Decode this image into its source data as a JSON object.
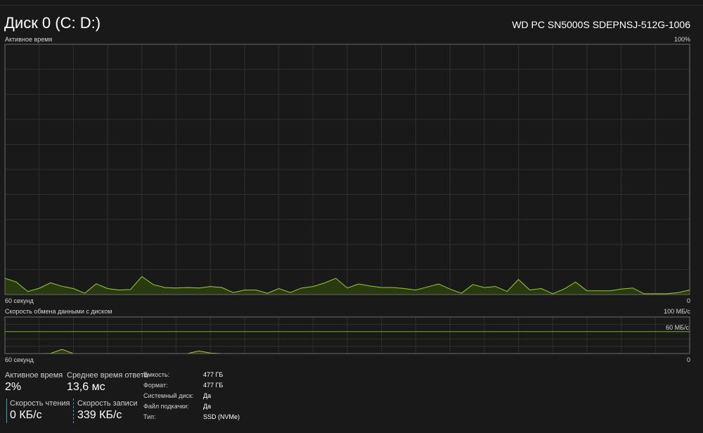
{
  "header": {
    "title": "Диск 0 (C: D:)",
    "model": "WD PC SN5000S SDEPNSJ-512G-1006"
  },
  "active_chart": {
    "label": "Активное время",
    "max_label": "100%",
    "time_label": "60 секунд",
    "min_label": "0",
    "line_color": "#9acd32",
    "fill_color": "#2a3a10"
  },
  "transfer_chart": {
    "label": "Скорость обмена данными с диском",
    "max_label": "100 МБ/с",
    "ref_label": "60 МБ/с",
    "time_label": "60 секунд",
    "min_label": "0"
  },
  "stats": {
    "active_time": {
      "label": "Активное время",
      "value": "2%"
    },
    "response_time": {
      "label": "Среднее время ответа",
      "value": "13,6 мс"
    },
    "read_speed": {
      "label": "Скорость чтения",
      "value": "0 КБ/с"
    },
    "write_speed": {
      "label": "Скорость записи",
      "value": "339 КБ/с"
    }
  },
  "properties": [
    {
      "label": "Емкость:",
      "value": "477 ГБ"
    },
    {
      "label": "Формат:",
      "value": "477 ГБ"
    },
    {
      "label": "Системный диск:",
      "value": "Да"
    },
    {
      "label": "Файл подкачки:",
      "value": "Да"
    },
    {
      "label": "Тип:",
      "value": "SSD (NVMe)"
    }
  ],
  "chart_data": [
    {
      "type": "area",
      "title": "Активное время",
      "ylim": [
        0,
        100
      ],
      "xlabel": "60 секунд",
      "series": [
        {
          "values": [
            6.5,
            5,
            1.2,
            2.5,
            4.7,
            3.3,
            2.4,
            0.5,
            4.3,
            2.4,
            1.8,
            2.0,
            7.2,
            4,
            2.8,
            2.6,
            2.8,
            2.6,
            3.2,
            2.8,
            0.8,
            1.8,
            1.8,
            0.5,
            2.4,
            0.8,
            2.6,
            3.2,
            4.6,
            6.5,
            2.6,
            4.2,
            3.4,
            2.8,
            2.8,
            2.4,
            1.8,
            3,
            4.2,
            2.2,
            0.5,
            4,
            2.8,
            3.2,
            1.2,
            6,
            1.8,
            2.4,
            0.3,
            2.2,
            5,
            1.5,
            1.5,
            1.5,
            2.2,
            2.6,
            0.3,
            0.3,
            0.3,
            0.8,
            1.8
          ]
        }
      ]
    },
    {
      "type": "area",
      "title": "Скорость обмена данными с диском",
      "ylim": [
        0,
        100
      ],
      "xlabel": "60 секунд",
      "series": [
        {
          "name": "Скорость записи",
          "values": [
            0,
            0,
            0,
            0,
            0.5,
            11.5,
            0,
            0,
            0,
            0,
            0,
            0,
            0,
            0,
            0,
            0,
            0,
            7.2,
            1.5,
            0,
            0,
            0,
            0,
            0,
            0,
            0,
            0,
            0,
            0,
            0,
            0,
            0,
            0,
            0,
            0,
            0,
            0,
            0,
            0,
            0,
            0,
            0,
            0,
            0,
            0,
            0,
            0,
            0,
            0,
            0,
            0,
            0,
            0,
            0,
            0,
            0,
            0,
            0,
            0,
            0,
            0
          ]
        }
      ]
    }
  ]
}
